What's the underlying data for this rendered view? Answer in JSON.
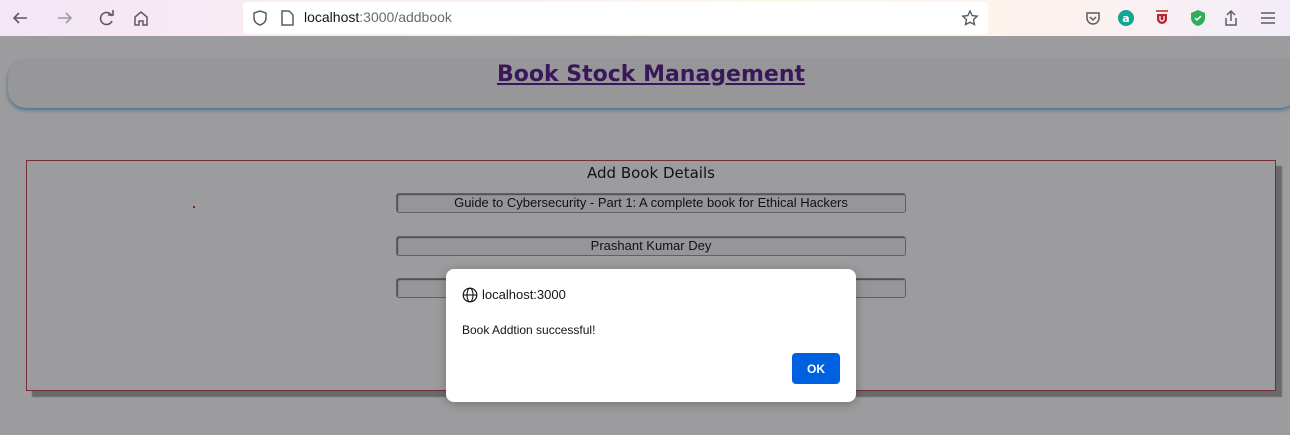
{
  "browser": {
    "url_host": "localhost",
    "url_path": ":3000/addbook",
    "icons": [
      "back-icon",
      "forward-icon",
      "reload-icon",
      "home-icon",
      "tracking-shield-icon",
      "page-icon",
      "bookmark-star-icon",
      "pocket-icon",
      "extension-a-icon",
      "extension-ublock-icon",
      "extension-shield-icon",
      "share-icon",
      "menu-icon"
    ]
  },
  "page": {
    "title": "Book Stock Management",
    "form": {
      "heading": "Add Book Details",
      "fields": [
        {
          "value": "Guide to Cybersecurity - Part 1: A complete book for Ethical Hackers"
        },
        {
          "value": "Prashant Kumar Dey"
        },
        {
          "value": ""
        }
      ]
    }
  },
  "dialog": {
    "origin": "localhost:3000",
    "message": "Book Addtion successful!",
    "ok_label": "OK"
  },
  "colors": {
    "title": "#551a8b",
    "ok_button": "#0061e0",
    "form_border": "#c0404a"
  }
}
